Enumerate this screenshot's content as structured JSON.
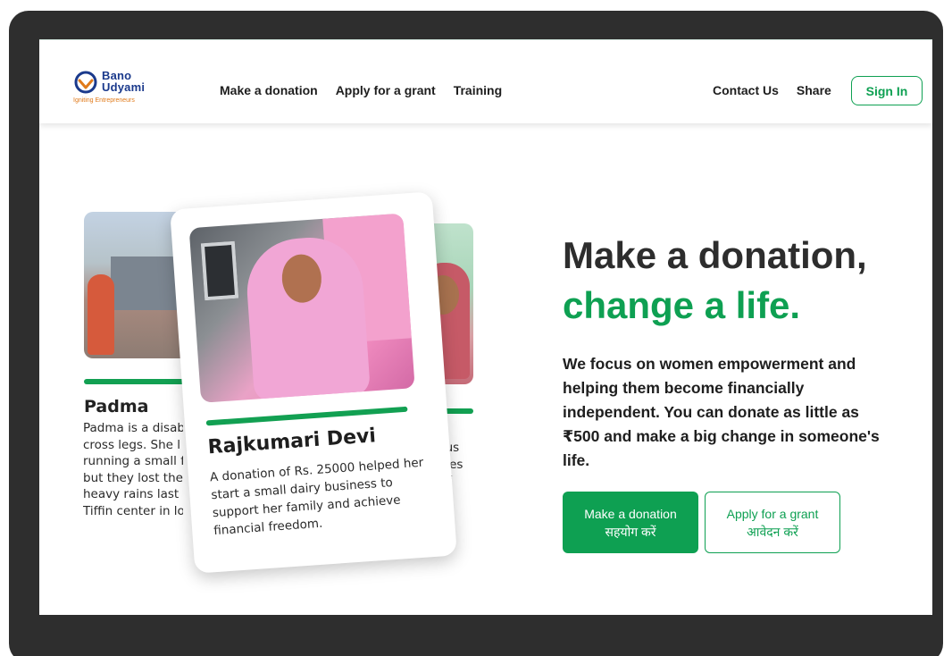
{
  "logo": {
    "line1": "Bano",
    "line2": "Udyami",
    "tagline": "Igniting Entrepreneurs"
  },
  "nav": {
    "left": [
      "Make a donation",
      "Apply for a grant",
      "Training"
    ],
    "right": [
      "Contact Us",
      "Share"
    ],
    "signin": "Sign In"
  },
  "cards": {
    "left": {
      "name": "Padma",
      "description": "Padma is a disab\ncross legs. She l\nrunning a small f\nbut they lost thei\nheavy rains last y\nTiffin center in loc"
    },
    "main": {
      "name": "Rajkumari Devi",
      "description": "A donation of Rs. 25000 helped her start a small dairy business to support her family and achieve financial freedom."
    },
    "right": {
      "description": "eous\n does\nself\ne"
    }
  },
  "hero": {
    "title_line1": "Make a donation,",
    "title_line2": "change a life.",
    "body": "We focus on women empowerment and helping them become financially independent. You can donate as little as ₹500 and make a big change in someone's life.",
    "primary_button": {
      "en": "Make a donation",
      "hi": "सहयोग करें"
    },
    "secondary_button": {
      "en": "Apply for a grant",
      "hi": "आवेदन करें"
    }
  },
  "colors": {
    "brand_green": "#0ea052",
    "logo_blue": "#1b3a8c",
    "logo_orange": "#e07a1a",
    "frame": "#2e2e2e"
  }
}
